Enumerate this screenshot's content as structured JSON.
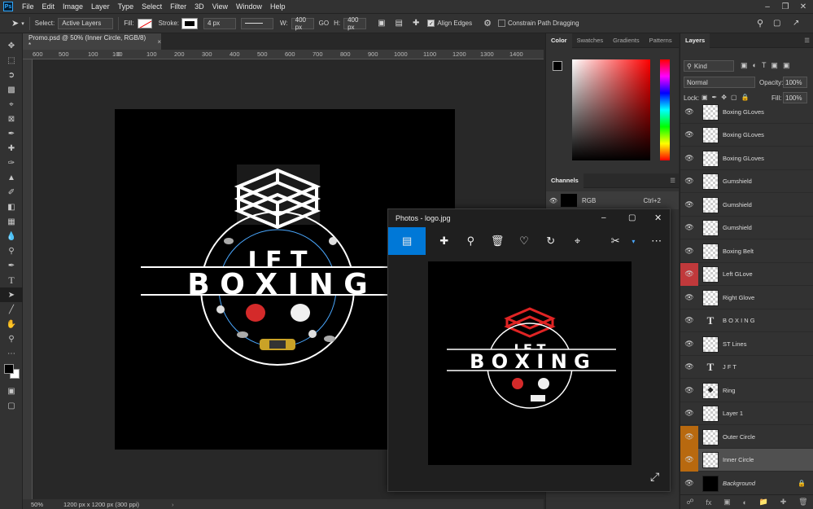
{
  "menubar": {
    "logo": "Ps",
    "items": [
      "File",
      "Edit",
      "Image",
      "Layer",
      "Type",
      "Select",
      "Filter",
      "3D",
      "View",
      "Window",
      "Help"
    ]
  },
  "options": {
    "select_label": "Select:",
    "select_value": "Active Layers",
    "fill_label": "Fill:",
    "stroke_label": "Stroke:",
    "stroke_width": "4 px",
    "w_label": "W:",
    "w_value": "400 px",
    "link_label": "GO",
    "h_label": "H:",
    "h_value": "400 px",
    "align_edges": "Align Edges",
    "constrain": "Constrain Path Dragging"
  },
  "document": {
    "tab_title": "Promo.psd @ 50% (Inner Circle, RGB/8) *",
    "close": "×",
    "ruler_ticks": [
      "600",
      "500",
      "100",
      "100",
      "0",
      "100",
      "200",
      "300",
      "400",
      "500",
      "600",
      "700",
      "800",
      "900",
      "1000",
      "1100",
      "1200",
      "1300",
      "1400"
    ],
    "zoom": "50%",
    "doc_info": "1200 px x 1200 px (300 ppi)"
  },
  "logo": {
    "line1": "J F T",
    "line2": "B O X I N G"
  },
  "color_panel": {
    "tabs": [
      "Color",
      "Swatches",
      "Gradients",
      "Patterns"
    ],
    "base_hue": "#ff0000"
  },
  "channels_panel": {
    "title": "Channels",
    "row_name": "RGB",
    "row_shortcut": "Ctrl+2"
  },
  "layers_panel": {
    "title": "Layers",
    "filter_kind": "Kind",
    "blend_mode": "Normal",
    "opacity_label": "Opacity:",
    "opacity_value": "100%",
    "lock_label": "Lock:",
    "fill_label": "Fill:",
    "fill_value": "100%",
    "layers": [
      {
        "name": "Boxing GLoves",
        "thumb": "check"
      },
      {
        "name": "Boxing GLoves",
        "thumb": "check"
      },
      {
        "name": "Boxing GLoves",
        "thumb": "check"
      },
      {
        "name": "Gumshield",
        "thumb": "check"
      },
      {
        "name": "Gumshield",
        "thumb": "check"
      },
      {
        "name": "Gumshield",
        "thumb": "check"
      },
      {
        "name": "Boxing Belt",
        "thumb": "check"
      },
      {
        "name": "Left GLove",
        "thumb": "check"
      },
      {
        "name": "Right Glove",
        "thumb": "check"
      },
      {
        "name": "B O X I N G",
        "thumb": "text"
      },
      {
        "name": "ST Lines",
        "thumb": "check"
      },
      {
        "name": "J F T",
        "thumb": "text"
      },
      {
        "name": "Ring",
        "thumb": "check"
      },
      {
        "name": "Layer 1",
        "thumb": "check"
      },
      {
        "name": "Outer Circle",
        "thumb": "shape"
      },
      {
        "name": "Inner Circle",
        "thumb": "shape"
      },
      {
        "name": "Background",
        "thumb": "black"
      }
    ]
  },
  "photos_app": {
    "title": "Photos - logo.jpg",
    "accent": "#0078d7"
  }
}
